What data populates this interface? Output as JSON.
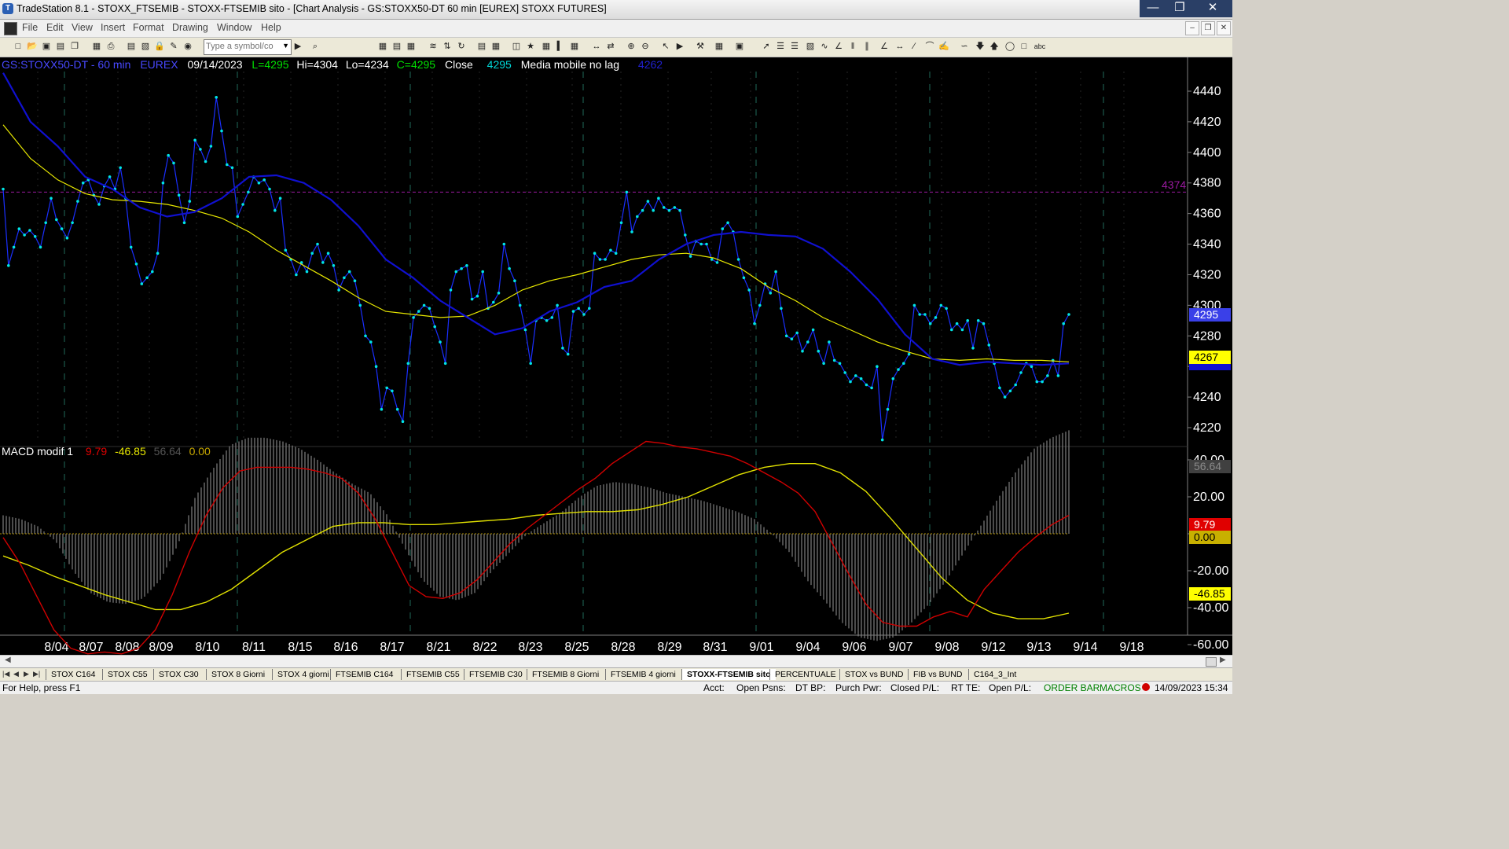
{
  "window": {
    "title": "TradeStation 8.1 - STOXX_FTSEMIB - STOXX-FTSEMIB sito - [Chart Analysis - GS:STOXX50-DT  60 min  [EUREX] STOXX FUTURES]"
  },
  "menu": [
    "File",
    "Edit",
    "View",
    "Insert",
    "Format",
    "Drawing",
    "Window",
    "Help"
  ],
  "toolbar": {
    "symbol_placeholder": "Type a symbol/co"
  },
  "chart_header": {
    "symbol": "GS:STOXX50-DT - 60 min",
    "exchange": "EUREX",
    "date": "09/14/2023",
    "last": "L=4295",
    "high": "Hi=4304",
    "low": "Lo=4234",
    "close": "C=4295",
    "close_label": "Close",
    "close_value": "4295",
    "ma_label": "Media mobile no lag",
    "ma_value": "4262"
  },
  "macd_header": {
    "name": "MACD modif 1",
    "v1": "9.79",
    "v2": "-46.85",
    "v3": "56.64",
    "v4": "0.00"
  },
  "price_tags": {
    "close": "4295",
    "ma_yellow": "4267",
    "ref_line": "4374"
  },
  "macd_tags": {
    "hist": "56.64",
    "macd": "9.79",
    "zero": "0.00",
    "signal": "-46.85"
  },
  "colors": {
    "price_line": "#1a2fff",
    "price_dots": "#00e5e5",
    "ma_blue": "#1010d0",
    "ma_yellow": "#e8e800",
    "macd_red": "#d00000",
    "macd_yellow": "#e0e000",
    "hist": "#808080",
    "ref_line": "#9a1aa0"
  },
  "statusbar": {
    "help": "For Help, press F1",
    "acct": "Acct:",
    "open_psns": "Open Psns:",
    "dt_bp": "DT BP:",
    "purch_pwr": "Purch Pwr:",
    "closed_pl": "Closed P/L:",
    "rt_te": "RT TE:",
    "open_pl": "Open P/L:",
    "order_bar": "ORDER BAR",
    "macros": "MACROS",
    "datetime": "14/09/2023 15:34"
  },
  "tabs": [
    "STOX C164",
    "STOX C55",
    "STOX  C30",
    "STOX  8 Giorni",
    "STOX 4 giorni",
    "FTSEMIB C164",
    "FTSEMIB C55",
    "FTSEMIB C30",
    "FTSEMIB  8 Giorni",
    "FTSEMIB  4 giorni",
    "STOXX-FTSEMIB sito",
    "PERCENTUALE",
    "STOX vs BUND",
    "FIB vs BUND",
    "C164_3_Int"
  ],
  "active_tab": "STOXX-FTSEMIB sito",
  "chart_data": [
    {
      "type": "line",
      "name": "GS:STOXX50-DT 60 min price",
      "x": [
        "8/04",
        "8/07",
        "8/08",
        "8/09",
        "8/10",
        "8/11",
        "8/15",
        "8/16",
        "8/17",
        "8/21",
        "8/22",
        "8/23",
        "8/25",
        "8/28",
        "8/29",
        "8/31",
        "9/01",
        "9/04",
        "9/06",
        "9/07",
        "9/08",
        "9/12",
        "9/13",
        "9/14",
        "9/18"
      ],
      "y_ticks": [
        4220,
        4240,
        4260,
        4280,
        4300,
        4320,
        4340,
        4360,
        4380,
        4400,
        4420,
        4440
      ],
      "ylim": [
        4208,
        4448
      ],
      "reference_line": 4374,
      "series": [
        {
          "name": "Close",
          "values": [
            4376,
            4326,
            4338,
            4350,
            4346,
            4349,
            4345,
            4338,
            4354,
            4370,
            4356,
            4350,
            4344,
            4354,
            4368,
            4380,
            4382,
            4372,
            4366,
            4378,
            4384,
            4376,
            4390,
            4370,
            4338,
            4327,
            4314,
            4318,
            4322,
            4334,
            4380,
            4398,
            4393,
            4372,
            4354,
            4368,
            4408,
            4402,
            4394,
            4404,
            4436,
            4414,
            4392,
            4390,
            4358,
            4366,
            4374,
            4384,
            4380,
            4382,
            4376,
            4362,
            4370,
            4336,
            4330,
            4320,
            4328,
            4322,
            4334,
            4340,
            4328,
            4334,
            4326,
            4310,
            4318,
            4322,
            4316,
            4300,
            4280,
            4276,
            4260,
            4232,
            4246,
            4244,
            4232,
            4224,
            4262,
            4292,
            4296,
            4300,
            4298,
            4286,
            4276,
            4262,
            4310,
            4322,
            4324,
            4326,
            4304,
            4306,
            4322,
            4298,
            4302,
            4308,
            4340,
            4324,
            4316,
            4300,
            4284,
            4262,
            4290,
            4292,
            4290,
            4292,
            4300,
            4272,
            4268,
            4296,
            4298,
            4294,
            4298,
            4334,
            4330,
            4330,
            4336,
            4334,
            4354,
            4374,
            4348,
            4358,
            4362,
            4368,
            4362,
            4370,
            4364,
            4362,
            4364,
            4362,
            4346,
            4332,
            4342,
            4340,
            4340,
            4330,
            4328,
            4350,
            4354,
            4348,
            4330,
            4318,
            4310,
            4288,
            4300,
            4314,
            4308,
            4322,
            4298,
            4280,
            4278,
            4282,
            4270,
            4276,
            4284,
            4270,
            4262,
            4276,
            4264,
            4262,
            4256,
            4250,
            4254,
            4252,
            4248,
            4246,
            4260,
            4212,
            4232,
            4252,
            4258,
            4262,
            4268,
            4300,
            4294,
            4294,
            4288,
            4292,
            4300,
            4298,
            4284,
            4288,
            4284,
            4290,
            4272,
            4290,
            4288,
            4274,
            4262,
            4246,
            4240,
            4244,
            4248,
            4256,
            4262,
            4260,
            4250,
            4250,
            4254,
            4264,
            4254,
            4288,
            4294
          ]
        },
        {
          "name": "Media mobile no lag (blue)",
          "values": [
            4452,
            4420,
            4404,
            4384,
            4376,
            4364,
            4358,
            4361,
            4370,
            4384,
            4385,
            4380,
            4369,
            4352,
            4330,
            4318,
            4303,
            4292,
            4281,
            4285,
            4296,
            4302,
            4312,
            4316,
            4330,
            4340,
            4346,
            4348,
            4346,
            4345,
            4337,
            4322,
            4304,
            4281,
            4265,
            4261,
            4263,
            4262,
            4261,
            4262
          ]
        },
        {
          "name": "Media mobile (yellow)",
          "values": [
            4418,
            4396,
            4382,
            4373,
            4369,
            4368,
            4366,
            4362,
            4357,
            4348,
            4336,
            4326,
            4316,
            4305,
            4296,
            4294,
            4292,
            4293,
            4300,
            4310,
            4316,
            4320,
            4325,
            4330,
            4333,
            4334,
            4331,
            4324,
            4312,
            4303,
            4292,
            4284,
            4276,
            4270,
            4265,
            4264,
            4265,
            4264,
            4264,
            4263
          ]
        }
      ]
    },
    {
      "type": "line",
      "name": "MACD modif 1",
      "y_ticks": [
        -60,
        -40,
        -20,
        0,
        20,
        40
      ],
      "ylim": [
        -78,
        62
      ],
      "series": [
        {
          "name": "MACD (red)",
          "values": [
            -2,
            -16,
            -34,
            -52,
            -62,
            -65,
            -64,
            -65,
            -62,
            -52,
            -33,
            -10,
            10,
            25,
            34,
            36,
            36,
            36,
            35,
            33,
            30,
            22,
            8,
            -10,
            -28,
            -34,
            -35,
            -32,
            -25,
            -15,
            -5,
            3,
            10,
            17,
            24,
            30,
            38,
            44,
            50,
            49,
            47,
            46,
            44,
            42,
            38,
            33,
            28,
            22,
            12,
            -5,
            -22,
            -38,
            -48,
            -50,
            -50,
            -45,
            -42,
            -45,
            -30,
            -20,
            -10,
            -2,
            5,
            10
          ]
        },
        {
          "name": "Signal (yellow)",
          "values": [
            -12,
            -17,
            -23,
            -28,
            -33,
            -37,
            -41,
            -41,
            -37,
            -30,
            -20,
            -10,
            -3,
            4,
            6,
            6,
            5,
            5,
            6,
            7,
            8,
            10,
            11,
            12,
            12,
            13,
            16,
            20,
            26,
            32,
            36,
            38,
            38,
            33,
            23,
            8,
            -8,
            -24,
            -36,
            -43,
            -46,
            -46,
            -43
          ]
        },
        {
          "name": "Histogram",
          "values": [
            10,
            8,
            4,
            -4,
            -20,
            -32,
            -37,
            -38,
            -35,
            -25,
            -6,
            20,
            35,
            48,
            52,
            52,
            50,
            46,
            40,
            33,
            27,
            22,
            10,
            -8,
            -25,
            -34,
            -36,
            -32,
            -20,
            -10,
            0,
            6,
            12,
            20,
            26,
            28,
            27,
            25,
            22,
            20,
            18,
            15,
            12,
            8,
            0,
            -10,
            -25,
            -36,
            -48,
            -56,
            -58,
            -56,
            -48,
            -38,
            -25,
            -10,
            5,
            20,
            34,
            46,
            52,
            56
          ]
        }
      ]
    }
  ]
}
